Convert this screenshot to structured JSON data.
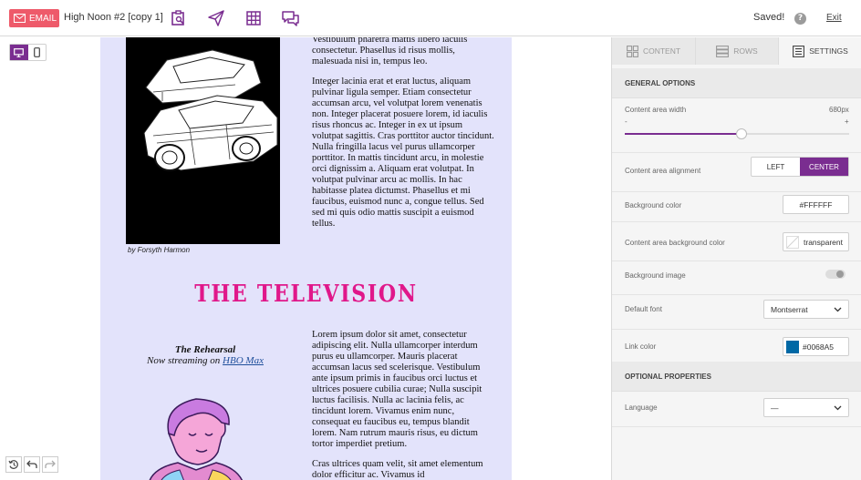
{
  "header": {
    "email_badge": "EMAIL",
    "doc_title": "High Noon #2 [copy 1]",
    "status": "Saved!",
    "help": "?",
    "exit": "Exit"
  },
  "icons": [
    "envelope-icon",
    "preview-icon",
    "send-icon",
    "grid-icon",
    "comments-icon",
    "desktop-icon",
    "mobile-icon",
    "history-icon",
    "undo-icon",
    "redo-icon"
  ],
  "email": {
    "para1": "Vestibulum pharetra mattis libero iaculis consectetur. Phasellus id risus mollis, malesuada nisi in, tempus leo.",
    "para2": "Integer lacinia erat et erat luctus, aliquam pulvinar ligula semper. Etiam consectetur accumsan arcu, vel volutpat lorem venenatis non. Integer placerat posuere lorem, id iaculis risus rhoncus ac. Integer in ex ut ipsum volutpat sagittis. Cras porttitor auctor tincidunt. Nulla fringilla lacus vel purus ullamcorper porttitor. In mattis tincidunt arcu, in molestie orci dignissim a. Aliquam erat volutpat. In volutpat pulvinar arcu ac mollis. In hac habitasse platea dictumst. Phasellus et mi faucibus, euismod nunc a, congue tellus. Sed sed mi quis odio mattis suscipit a euismod tellus.",
    "caption": "by Forsyth Harmon",
    "section_title": "THE TELEVISION",
    "rehearsal_title": "The Rehearsal",
    "rehearsal_sub": "Now streaming on ",
    "rehearsal_link": "HBO Max",
    "para3": "Lorem ipsum dolor sit amet, consectetur adipiscing elit. Nulla ullamcorper interdum purus eu ullamcorper. Mauris placerat accumsan lacus sed scelerisque. Vestibulum ante ipsum primis in faucibus orci luctus et ultrices posuere cubilia curae; Nulla suscipit luctus facilisis. Nulla ac lacinia felis, ac tincidunt lorem. Vivamus enim nunc, consequat eu faucibus eu, tempus blandit lorem. Nam rutrum mauris risus, eu dictum tortor imperdiet pretium.",
    "para4": "Cras ultrices quam velit, sit amet elementum dolor efficitur ac. Vivamus id"
  },
  "panel": {
    "tabs": [
      {
        "label": "CONTENT",
        "active": false
      },
      {
        "label": "ROWS",
        "active": false
      },
      {
        "label": "SETTINGS",
        "active": true
      }
    ],
    "general_options": "GENERAL OPTIONS",
    "content_width_label": "Content area width",
    "content_width_value": "680px",
    "slider_minus": "-",
    "slider_plus": "+",
    "slider_fraction": 0.5,
    "alignment_label": "Content area alignment",
    "align_left": "LEFT",
    "align_center": "CENTER",
    "bg_color_label": "Background color",
    "bg_color_value": "#FFFFFF",
    "content_bg_label": "Content area background color",
    "content_bg_value": "transparent",
    "bg_image_label": "Background image",
    "default_font_label": "Default font",
    "default_font_value": "Montserrat",
    "link_color_label": "Link color",
    "link_color_value": "#0068A5",
    "optional_props": "OPTIONAL PROPERTIES",
    "language_label": "Language",
    "language_value": "—"
  },
  "colors": {
    "accent": "#7a2d90",
    "email_badge": "#ee5a6a",
    "email_bg": "#e3e3fb",
    "title_pink": "#e0188a",
    "link": "#0068A5"
  }
}
